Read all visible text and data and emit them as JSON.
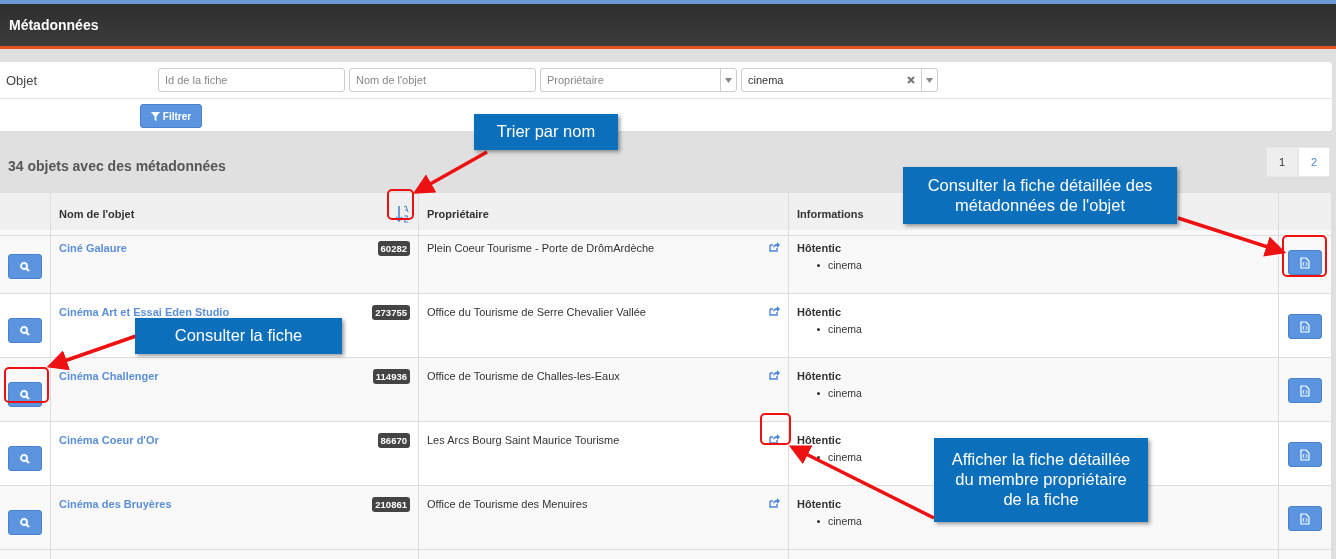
{
  "header": {
    "title": "Métadonnées"
  },
  "filters": {
    "label": "Objet",
    "fields": [
      {
        "kind": "text",
        "placeholder": "Id de la fiche"
      },
      {
        "kind": "text",
        "placeholder": "Nom de l'objet"
      },
      {
        "kind": "select",
        "placeholder": "Propriétaire"
      },
      {
        "kind": "select",
        "value": "cinema",
        "clearable": true
      }
    ],
    "button": "Filtrer"
  },
  "summary": "34 objets avec des métadonnées",
  "pagination": [
    {
      "label": "1",
      "selected": true
    },
    {
      "label": "2",
      "selected": false
    }
  ],
  "table": {
    "columns": [
      "Nom de l'objet",
      "Propriétaire",
      "Informations"
    ],
    "rows": [
      {
        "name": "Ciné Galaure",
        "id": "60282",
        "owner": "Plein Coeur Tourisme - Porte de DrômArdèche",
        "info_title": "Hôtentic",
        "tags": [
          "cinema"
        ]
      },
      {
        "name": "Cinéma Art et Essai Eden Studio",
        "id": "273755",
        "owner": "Office du Tourisme de Serre Chevalier Vallée",
        "info_title": "Hôtentic",
        "tags": [
          "cinema"
        ]
      },
      {
        "name": "Cinéma Challenger",
        "id": "114936",
        "owner": "Office de Tourisme de Challes-les-Eaux",
        "info_title": "Hôtentic",
        "tags": [
          "cinema"
        ]
      },
      {
        "name": "Cinéma Coeur d'Or",
        "id": "86670",
        "owner": "Les Arcs Bourg Saint Maurice Tourisme",
        "info_title": "Hôtentic",
        "tags": [
          "cinema"
        ]
      },
      {
        "name": "Cinéma des Bruyères",
        "id": "210861",
        "owner": "Office de Tourisme des Menuires",
        "info_title": "Hôtentic",
        "tags": [
          "cinema"
        ]
      }
    ]
  },
  "annotations": [
    {
      "text": "Trier par nom"
    },
    {
      "text": "Consulter la fiche détaillée des métadonnées de l'objet"
    },
    {
      "text": "Consulter la fiche"
    },
    {
      "text": "Afficher la fiche détaillée du membre propriétaire de la fiche"
    }
  ]
}
